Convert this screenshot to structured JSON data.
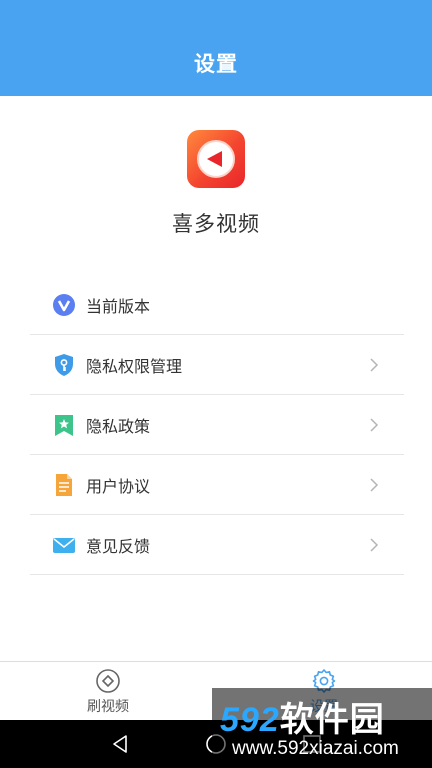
{
  "header": {
    "title": "设置"
  },
  "app": {
    "name": "喜多视频"
  },
  "menu": {
    "items": [
      {
        "label": "当前版本",
        "icon": "version-v-icon",
        "has_arrow": false
      },
      {
        "label": "隐私权限管理",
        "icon": "privacy-shield-icon",
        "has_arrow": true
      },
      {
        "label": "隐私政策",
        "icon": "bookmark-star-icon",
        "has_arrow": true
      },
      {
        "label": "用户协议",
        "icon": "document-icon",
        "has_arrow": true
      },
      {
        "label": "意见反馈",
        "icon": "mail-icon",
        "has_arrow": true
      }
    ]
  },
  "tabbar": {
    "tabs": [
      {
        "label": "刷视频",
        "icon": "play-circle-icon",
        "active": false
      },
      {
        "label": "设置",
        "icon": "gear-icon",
        "active": true
      }
    ]
  },
  "watermark": {
    "brand": "592",
    "brand_cn": "软件园",
    "url": "www.592xiazai.com"
  },
  "colors": {
    "primary": "#4aa3f0",
    "text": "#333333",
    "divider": "#e6e6e6",
    "logo_red": "#f4452f",
    "logo_orange": "#ff8a3d"
  }
}
